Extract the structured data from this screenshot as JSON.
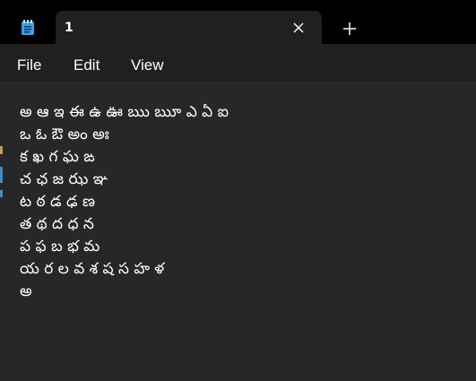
{
  "tab": {
    "title": "1"
  },
  "icons": {
    "app": "notepad-icon",
    "close": "close-icon",
    "new_tab": "plus-icon"
  },
  "menu": {
    "file": "File",
    "edit": "Edit",
    "view": "View"
  },
  "editor": {
    "lines": [
      "అ ఆ ఇ ఈ ఉ ఊ ఋ ౠ ఎ ఏ ఐ",
      "ఒ ఓ ఔ అం అః",
      "క ఖ గ ఘ ఙ",
      "చ ఛ జ ఝ ఞ",
      "ట ఠ డ ఢ ణ",
      "త థ ద ధ న",
      "ప ఫ బ భ మ",
      "య ర ల వ శ ష స హ ళ",
      "అ"
    ]
  },
  "colors": {
    "titlebar": "#000000",
    "tab": "#202020",
    "menubar": "#202020",
    "editor": "#272727",
    "text": "#ffffff",
    "icon_accent": "#4cc2ff"
  }
}
